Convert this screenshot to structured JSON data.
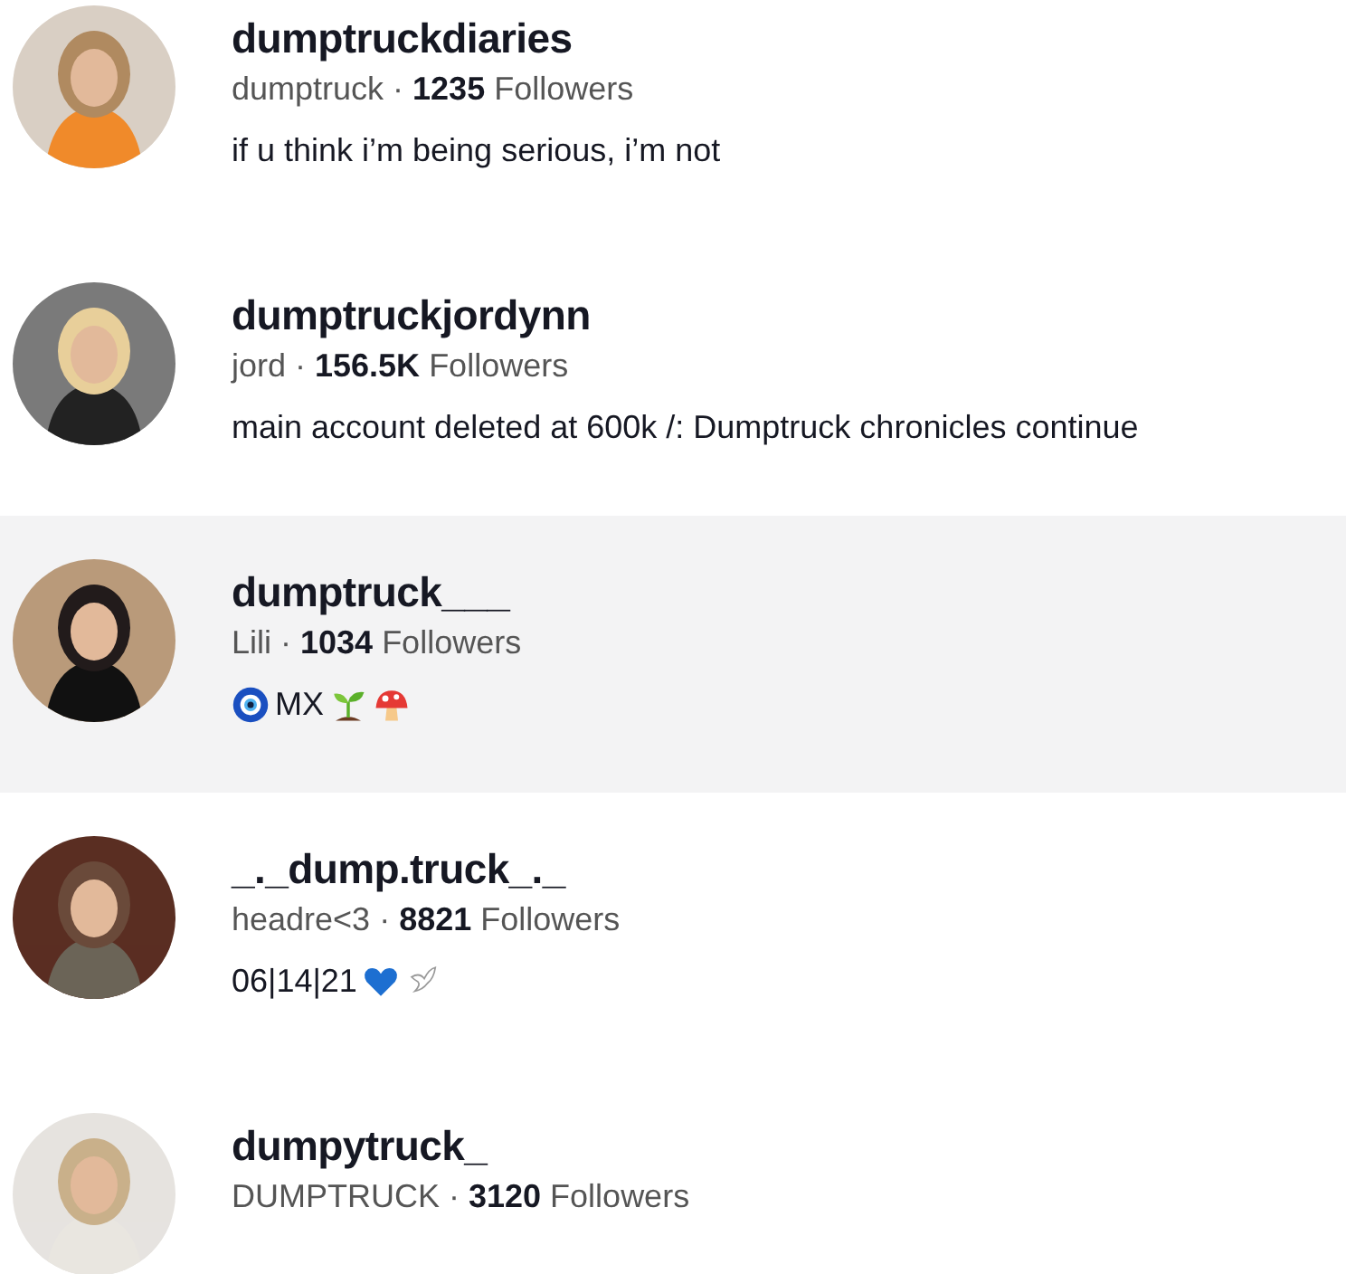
{
  "results": [
    {
      "name": "dumptruckdiaries",
      "subtitle": "dumptruck · **1235** Followers",
      "hovered": false,
      "bio": [
        {
          "kind": "text",
          "text": "if u think i’m being serious, i’m not"
        }
      ]
    },
    {
      "name": "dumptruckjordynn",
      "subtitle": "jord · **156.5K** Followers",
      "hovered": false,
      "bio": [
        {
          "kind": "text",
          "text": "main account deleted at 600k /: Dumptruck chronicles continue"
        }
      ]
    },
    {
      "name": "dumptruck___",
      "subtitle": "Lili · **1034** Followers",
      "hovered": true,
      "bio": [
        {
          "kind": "nazar"
        },
        {
          "kind": "text",
          "text": "MX"
        },
        {
          "kind": "sprout"
        },
        {
          "kind": "mushroom"
        }
      ]
    },
    {
      "name": "_._dump.truck_._",
      "subtitle": "headre<3 · **8821** Followers",
      "hovered": false,
      "bio": [
        {
          "kind": "text",
          "text": "06|14|21"
        },
        {
          "kind": "heart"
        },
        {
          "kind": "dove"
        }
      ]
    },
    {
      "name": "dumpytruck_",
      "subtitle": "DUMPTRUCK · **3120** Followers",
      "hovered": false
    }
  ]
}
